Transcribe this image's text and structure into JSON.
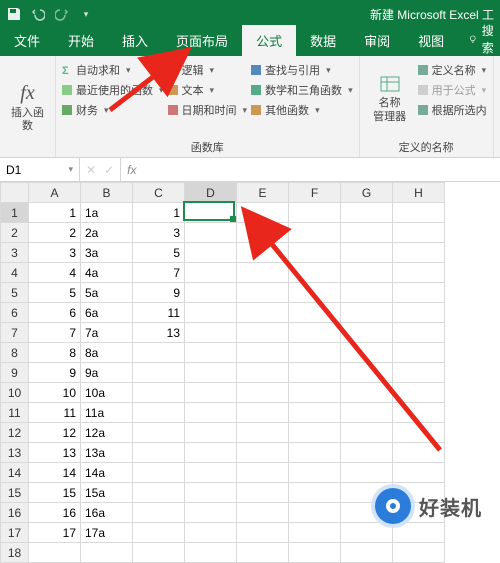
{
  "title_bar": {
    "title": "新建 Microsoft Excel 工"
  },
  "tabs": {
    "file": "文件",
    "home": "开始",
    "insert": "插入",
    "layout": "页面布局",
    "formulas": "公式",
    "data": "数据",
    "review": "审阅",
    "view": "视图",
    "search": "搜索"
  },
  "ribbon": {
    "insert_fn": "插入函数",
    "autosum": "自动求和",
    "recent": "最近使用的函数",
    "financial": "财务",
    "logical": "逻辑",
    "text": "文本",
    "datetime": "日期和时间",
    "lookup": "查找与引用",
    "math": "数学和三角函数",
    "more": "其他函数",
    "lib_label": "函数库",
    "name_mgr": "名称\n管理器",
    "define_name": "定义名称",
    "use_in_fn": "用于公式",
    "from_sel": "根据所选内",
    "names_label": "定义的名称"
  },
  "namebox": "D1",
  "columns": [
    "A",
    "B",
    "C",
    "D",
    "E",
    "F",
    "G",
    "H"
  ],
  "rows": [
    {
      "n": 1,
      "A": "1",
      "B": "1a",
      "C": "1"
    },
    {
      "n": 2,
      "A": "2",
      "B": "2a",
      "C": "3"
    },
    {
      "n": 3,
      "A": "3",
      "B": "3a",
      "C": "5"
    },
    {
      "n": 4,
      "A": "4",
      "B": "4a",
      "C": "7"
    },
    {
      "n": 5,
      "A": "5",
      "B": "5a",
      "C": "9"
    },
    {
      "n": 6,
      "A": "6",
      "B": "6a",
      "C": "11"
    },
    {
      "n": 7,
      "A": "7",
      "B": "7a",
      "C": "13"
    },
    {
      "n": 8,
      "A": "8",
      "B": "8a",
      "C": ""
    },
    {
      "n": 9,
      "A": "9",
      "B": "9a",
      "C": ""
    },
    {
      "n": 10,
      "A": "10",
      "B": "10a",
      "C": ""
    },
    {
      "n": 11,
      "A": "11",
      "B": "11a",
      "C": ""
    },
    {
      "n": 12,
      "A": "12",
      "B": "12a",
      "C": ""
    },
    {
      "n": 13,
      "A": "13",
      "B": "13a",
      "C": ""
    },
    {
      "n": 14,
      "A": "14",
      "B": "14a",
      "C": ""
    },
    {
      "n": 15,
      "A": "15",
      "B": "15a",
      "C": ""
    },
    {
      "n": 16,
      "A": "16",
      "B": "16a",
      "C": ""
    },
    {
      "n": 17,
      "A": "17",
      "B": "17a",
      "C": ""
    },
    {
      "n": 18,
      "A": "",
      "B": "",
      "C": ""
    }
  ],
  "watermark": "好装机"
}
